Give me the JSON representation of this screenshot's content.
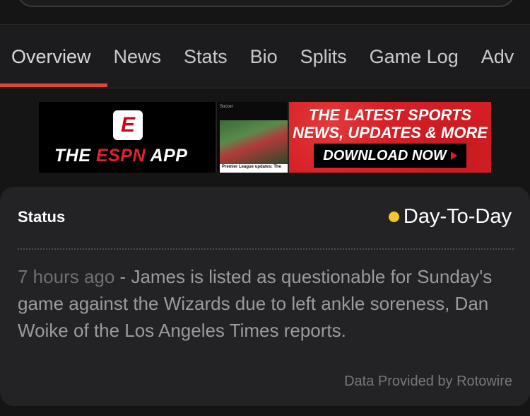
{
  "tabs": [
    {
      "label": "Overview",
      "active": true
    },
    {
      "label": "News",
      "active": false
    },
    {
      "label": "Stats",
      "active": false
    },
    {
      "label": "Bio",
      "active": false
    },
    {
      "label": "Splits",
      "active": false
    },
    {
      "label": "Game Log",
      "active": false
    },
    {
      "label": "Adv",
      "active": false
    }
  ],
  "banner": {
    "logo_letter": "E",
    "app_prefix": "THE ",
    "app_brand": "ESPN",
    "app_suffix": " APP",
    "phone_header": "Soccer",
    "phone_caption": "Premier League updates: The",
    "promo_line1": "THE LATEST SPORTS",
    "promo_line2": "NEWS, UPDATES & MORE",
    "download_label": "DOWNLOAD NOW"
  },
  "status": {
    "label": "Status",
    "value": "Day-To-Day",
    "dot_color": "#f4c62a",
    "note_time": "7 hours ago",
    "note_separator": " - ",
    "note_text": "James is listed as questionable for Sunday's game against the Wizards due to left ankle soreness, Dan Woike of the Los Angeles Times reports.",
    "credit": "Data Provided by Rotowire"
  },
  "colors": {
    "accent": "#e0453a",
    "background": "#151516",
    "card": "#232325"
  }
}
